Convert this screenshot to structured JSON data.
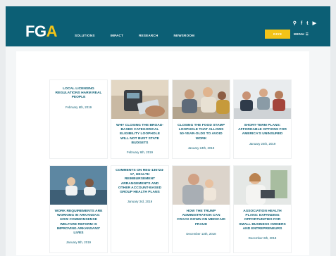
{
  "header": {
    "logo_main": "FG",
    "logo_accent": "A",
    "nav": [
      "SOLUTIONS",
      "IMPACT",
      "RESEARCH",
      "NEWSROOM"
    ],
    "icons": [
      "search-icon",
      "facebook-icon",
      "twitter-icon",
      "youtube-icon"
    ],
    "give_label": "GIVE",
    "menu_label": "MENU ☰"
  },
  "cards": [
    {
      "title": "LOCAL LICENSING REGULATIONS HARM REAL PEOPLE",
      "date": "February 6th, 2019",
      "image": "none"
    },
    {
      "title": "WHY CLOSING THE BROAD-BASED CATEGORICAL ELIGIBILITY LOOPHOLE WILL NOT BUST STATE BUDGETS",
      "date": "February 6th, 2019",
      "image": "card-payment-photo"
    },
    {
      "title": "CLOSING THE FOOD STAMP LOOPHOLE THAT ALLOWS 50-YEAR-OLDS TO AVOID WORK",
      "date": "January 24th, 2019",
      "image": "meeting-photo"
    },
    {
      "title": "SHORT-TERM PLANS: AFFORDABLE OPTIONS FOR AMERICA'S UNINSURED",
      "date": "January 24th, 2019",
      "image": "office-team-photo"
    },
    {
      "title": "WORK REQUIREMENTS ARE WORKING IN ARKANSAS: HOW COMMONSENSE WELFARE REFORM IS IMPROVING ARKANSANS' LIVES",
      "date": "January 9th, 2019",
      "image": "workers-photo"
    },
    {
      "title": "COMMENTS ON REG-136724-17, HEALTH REIMBURSEMENT ARRANGEMENTS AND OTHER ACCOUNT-BASED GROUP HEALTH PLANS",
      "date": "January 3rd, 2019",
      "image": "none"
    },
    {
      "title": "HOW THE TRUMP ADMINISTRATION CAN CRACK DOWN ON MEDICAID FRAUD",
      "date": "December 13th, 2018",
      "image": "family-photo"
    },
    {
      "title": "ASSOCIATION HEALTH PLANS: EXPANDING OPPORTUNITIES FOR SMALL BUSINESS OWNERS AND ENTREPRENEURS",
      "date": "December 6th, 2018",
      "image": "business-owner-photo"
    }
  ]
}
